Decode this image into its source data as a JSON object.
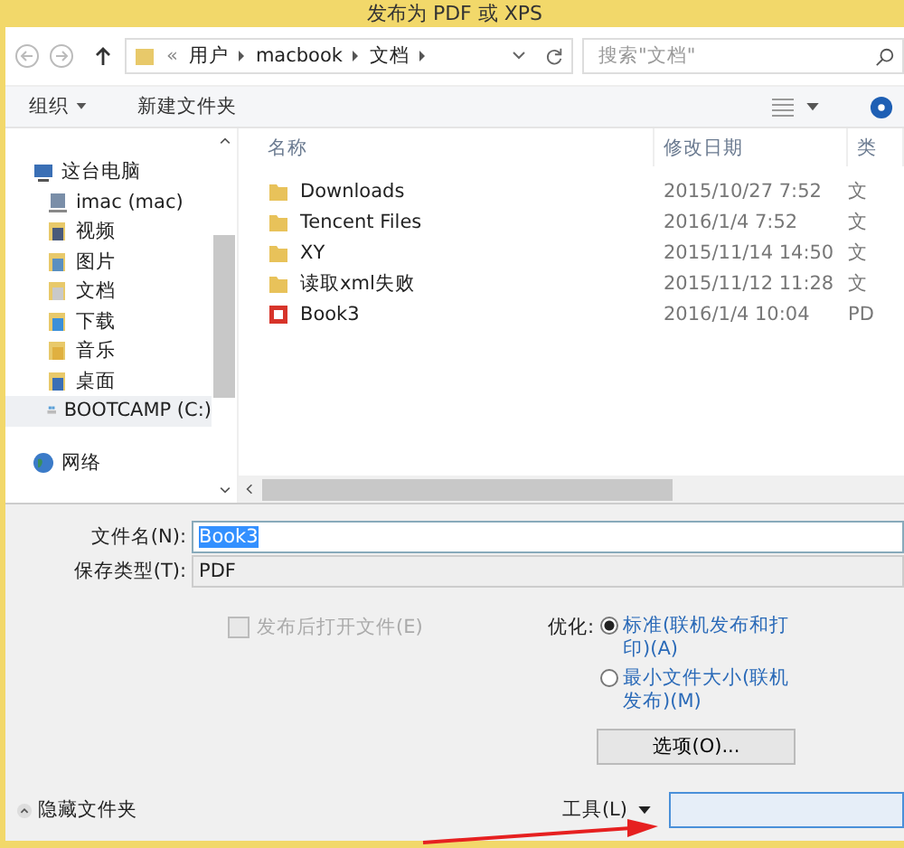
{
  "window": {
    "title": "发布为 PDF 或 XPS"
  },
  "address_bar": {
    "overflow": "«",
    "crumbs": [
      "用户",
      "macbook",
      "文档"
    ]
  },
  "search": {
    "placeholder": "搜索\"文档\""
  },
  "toolbar": {
    "organize": "组织",
    "new_folder": "新建文件夹"
  },
  "sidebar": {
    "items": [
      {
        "label": "这台电脑",
        "kind": "computer",
        "selected": false,
        "children": [
          {
            "label": "imac (mac)",
            "kind": "netdrive",
            "selected": false
          },
          {
            "label": "视频",
            "kind": "video",
            "selected": false
          },
          {
            "label": "图片",
            "kind": "picture",
            "selected": false
          },
          {
            "label": "文档",
            "kind": "document",
            "selected": false
          },
          {
            "label": "下载",
            "kind": "download",
            "selected": false
          },
          {
            "label": "音乐",
            "kind": "music",
            "selected": false
          },
          {
            "label": "桌面",
            "kind": "desktop",
            "selected": false
          },
          {
            "label": "BOOTCAMP (C:)",
            "kind": "drive",
            "selected": true
          }
        ]
      },
      {
        "label": "网络",
        "kind": "network",
        "selected": false
      }
    ]
  },
  "table": {
    "columns": [
      "名称",
      "修改日期",
      "类"
    ],
    "rows": [
      {
        "kind": "folder",
        "name": "Downloads",
        "date": "2015/10/27 7:52",
        "type": "文"
      },
      {
        "kind": "folder",
        "name": "Tencent Files",
        "date": "2016/1/4 7:52",
        "type": "文"
      },
      {
        "kind": "folder",
        "name": "XY",
        "date": "2015/11/14 14:50",
        "type": "文"
      },
      {
        "kind": "folder",
        "name": "读取xml失败",
        "date": "2015/11/12 11:28",
        "type": "文"
      },
      {
        "kind": "pdf",
        "name": "Book3",
        "date": "2016/1/4 10:04",
        "type": "PD"
      }
    ]
  },
  "file_name": {
    "label": "文件名(N):",
    "value": "Book3"
  },
  "save_type": {
    "label": "保存类型(T):",
    "value": "PDF"
  },
  "open_after": {
    "label": "发布后打开文件(E)",
    "checked": false,
    "disabled": true
  },
  "optimize": {
    "label": "优化:",
    "options": [
      {
        "label": "标准(联机发布和打印)(A)",
        "selected": true
      },
      {
        "label": "最小文件大小(联机发布)(M)",
        "selected": false
      }
    ]
  },
  "options_button": "选项(O)...",
  "hide_folders": "隐藏文件夹",
  "tools": "工具(L)"
}
